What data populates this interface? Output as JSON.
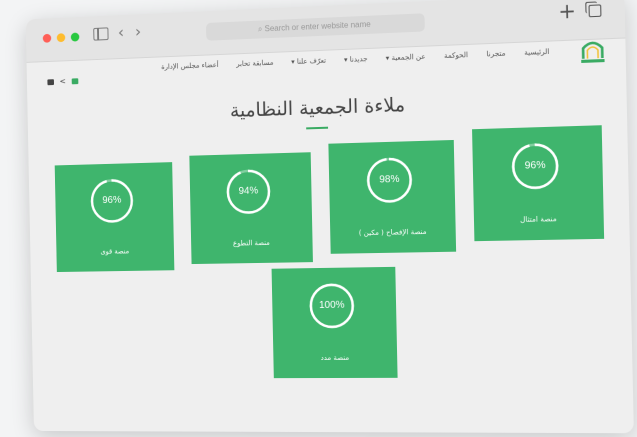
{
  "browser": {
    "url_placeholder": "Search or enter website name",
    "back_glyph": "‹",
    "forward_glyph": "›",
    "plus_glyph": "+",
    "traffic_colors": [
      "#ff5f57",
      "#febc2e",
      "#28c840"
    ]
  },
  "nav": {
    "items": [
      "الرئيسية",
      "متجرنا",
      "الحوكمة",
      "عن الجمعية ▾",
      "جديدنا ▾",
      "تعرّف علنا ▾",
      "مسابقة تحابر",
      "أعضاء مجلس الإدارة"
    ],
    "share_glyph": "<"
  },
  "page": {
    "title": "ملاءة الجمعية النظامية"
  },
  "cards": [
    {
      "percent": "96%",
      "value": 96,
      "label": "منصة امتثال"
    },
    {
      "percent": "98%",
      "value": 98,
      "label": "منصة الإفصاح ( مكين )"
    },
    {
      "percent": "94%",
      "value": 94,
      "label": "منصة التطوع"
    },
    {
      "percent": "96%",
      "value": 96,
      "label": "منصة قوى"
    },
    {
      "percent": "100%",
      "value": 100,
      "label": "منصة مدد"
    }
  ],
  "colors": {
    "accent": "#3fb56d",
    "brand_green": "#3aab63"
  }
}
